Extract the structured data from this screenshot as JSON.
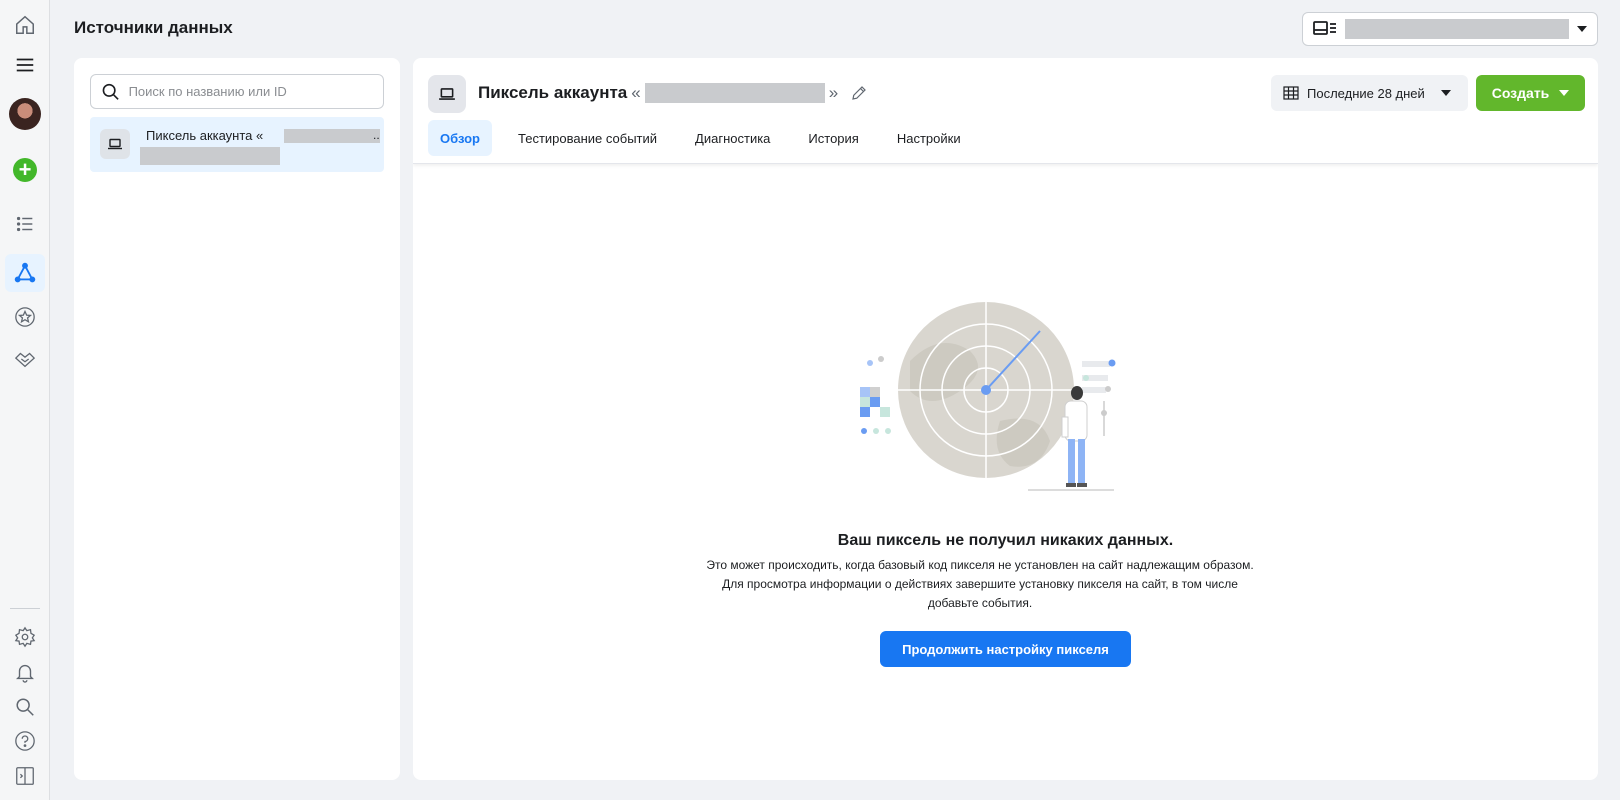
{
  "header": {
    "title": "Источники данных",
    "account_selector_icon": "business-card-icon"
  },
  "sidebar": {
    "items": [
      {
        "name": "home",
        "icon": "home-icon"
      },
      {
        "name": "menu",
        "icon": "menu-icon"
      },
      {
        "name": "profile",
        "icon": "avatar"
      },
      {
        "name": "create",
        "icon": "plus-circle-icon"
      },
      {
        "name": "list",
        "icon": "list-icon"
      },
      {
        "name": "data-sources",
        "icon": "network-icon",
        "active": true
      },
      {
        "name": "favorites",
        "icon": "star-circle-icon"
      },
      {
        "name": "partners",
        "icon": "handshake-icon"
      },
      {
        "name": "settings",
        "icon": "gear-icon"
      },
      {
        "name": "notifications",
        "icon": "bell-icon"
      },
      {
        "name": "search",
        "icon": "search-icon"
      },
      {
        "name": "help",
        "icon": "help-icon"
      },
      {
        "name": "collapse",
        "icon": "collapse-panel-icon"
      }
    ]
  },
  "list": {
    "search_placeholder": "Поиск по названию или ID",
    "items": [
      {
        "label": "Пиксель аккаунта «",
        "ellipsis": "..",
        "selected": true
      }
    ]
  },
  "main": {
    "pixel_title_prefix": "Пиксель аккаунта",
    "quote_open": "«",
    "quote_close": "»",
    "date_range_label": "Последние 28 дней",
    "create_label": "Создать",
    "tabs": [
      {
        "label": "Обзор",
        "active": true
      },
      {
        "label": "Тестирование событий"
      },
      {
        "label": "Диагностика"
      },
      {
        "label": "История"
      },
      {
        "label": "Настройки"
      }
    ],
    "empty_state": {
      "title": "Ваш пиксель не получил никаких данных.",
      "description": "Это может происходить, когда базовый код пикселя не установлен на сайт надлежащим образом. Для просмотра информации о действиях завершите установку пикселя на сайт, в том числе добавьте события.",
      "cta_label": "Продолжить настройку пикселя"
    }
  },
  "colors": {
    "primary_blue": "#1877f2",
    "create_green": "#62b72c",
    "active_bg": "#e7f3ff",
    "page_bg": "#f0f2f5"
  }
}
